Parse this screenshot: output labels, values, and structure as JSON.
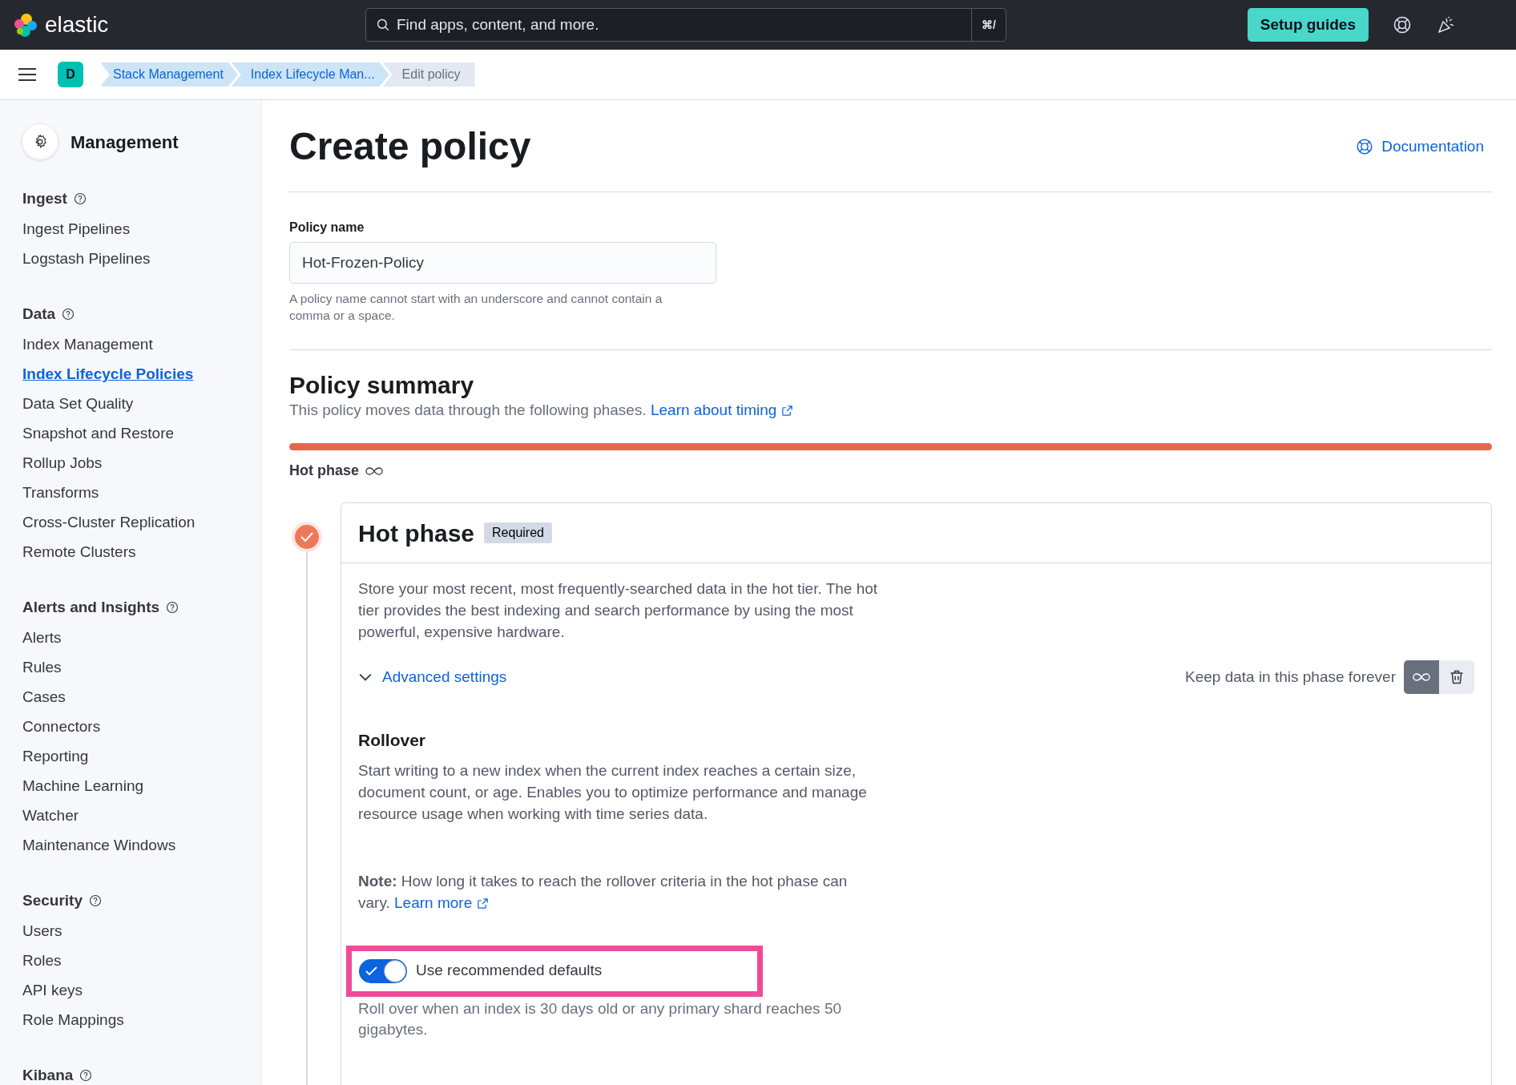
{
  "header": {
    "brand": "elastic",
    "search": {
      "placeholder": "Find apps, content, and more.",
      "shortcut": "⌘/"
    },
    "setup_button": "Setup guides"
  },
  "breadcrumbs": {
    "space": "D",
    "items": [
      {
        "label": "Stack Management",
        "current": false
      },
      {
        "label": "Index Lifecycle Man...",
        "current": false
      },
      {
        "label": "Edit policy",
        "current": true
      }
    ]
  },
  "sidebar": {
    "title": "Management",
    "groups": [
      {
        "heading": "Ingest",
        "items": [
          {
            "label": "Ingest Pipelines",
            "selected": false
          },
          {
            "label": "Logstash Pipelines",
            "selected": false
          }
        ]
      },
      {
        "heading": "Data",
        "items": [
          {
            "label": "Index Management",
            "selected": false
          },
          {
            "label": "Index Lifecycle Policies",
            "selected": true
          },
          {
            "label": "Data Set Quality",
            "selected": false
          },
          {
            "label": "Snapshot and Restore",
            "selected": false
          },
          {
            "label": "Rollup Jobs",
            "selected": false
          },
          {
            "label": "Transforms",
            "selected": false
          },
          {
            "label": "Cross-Cluster Replication",
            "selected": false
          },
          {
            "label": "Remote Clusters",
            "selected": false
          }
        ]
      },
      {
        "heading": "Alerts and Insights",
        "items": [
          {
            "label": "Alerts",
            "selected": false
          },
          {
            "label": "Rules",
            "selected": false
          },
          {
            "label": "Cases",
            "selected": false
          },
          {
            "label": "Connectors",
            "selected": false
          },
          {
            "label": "Reporting",
            "selected": false
          },
          {
            "label": "Machine Learning",
            "selected": false
          },
          {
            "label": "Watcher",
            "selected": false
          },
          {
            "label": "Maintenance Windows",
            "selected": false
          }
        ]
      },
      {
        "heading": "Security",
        "items": [
          {
            "label": "Users",
            "selected": false
          },
          {
            "label": "Roles",
            "selected": false
          },
          {
            "label": "API keys",
            "selected": false
          },
          {
            "label": "Role Mappings",
            "selected": false
          }
        ]
      },
      {
        "heading": "Kibana"
      }
    ]
  },
  "page": {
    "title": "Create policy",
    "documentation_link": "Documentation",
    "policy_name": {
      "label": "Policy name",
      "value": "Hot-Frozen-Policy",
      "help": "A policy name cannot start with an underscore and cannot contain a comma or a space."
    },
    "summary": {
      "title": "Policy summary",
      "text": "This policy moves data through the following phases.",
      "link": "Learn about timing",
      "bar_label": "Hot phase"
    },
    "phase": {
      "title": "Hot phase",
      "badge": "Required",
      "complete": true,
      "description": "Store your most recent, most frequently-searched data in the hot tier. The hot tier provides the best indexing and search performance by using the most powerful, expensive hardware.",
      "advanced_settings": {
        "label": "Advanced settings",
        "expanded": true
      },
      "keep_forever": {
        "label": "Keep data in this phase forever",
        "selected": true
      },
      "rollover": {
        "title": "Rollover",
        "text": "Start writing to a new index when the current index reaches a certain size, document count, or age. Enables you to optimize performance and manage resource usage when working with time series data.",
        "note": "**Note:** How long it takes to reach the rollover criteria in the hot phase can vary.",
        "note_link": "Learn more",
        "toggle": {
          "label": "Use recommended defaults",
          "on": true,
          "highlighted": true
        },
        "toggle_help": "Roll over when an index is 30 days old or any primary shard reaches 50 gigabytes."
      }
    }
  }
}
